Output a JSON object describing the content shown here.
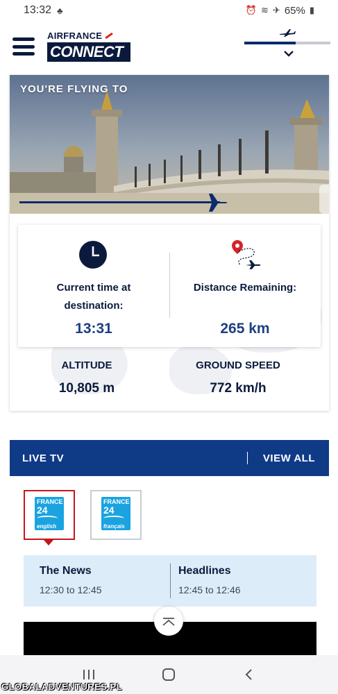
{
  "status_bar": {
    "time": "13:32",
    "battery": "65%"
  },
  "header": {
    "logo_top": "AIRFRANCE",
    "logo_bottom": "CONNECT",
    "progress_fraction": 0.6
  },
  "flight": {
    "hero_title": "YOU'RE FLYING TO",
    "route_progress_fraction": 0.67,
    "current_time_label": "Current time at destination:",
    "current_time_value": "13:31",
    "distance_label": "Distance Remaining:",
    "distance_value": "265 km",
    "altitude_label": "ALTITUDE",
    "altitude_value": "10,805 m",
    "ground_speed_label": "GROUND SPEED",
    "ground_speed_value": "772 km/h"
  },
  "live_tv": {
    "title": "LIVE TV",
    "view_all": "VIEW ALL",
    "channels": [
      {
        "name": "FRANCE",
        "number": "24",
        "lang": "english",
        "selected": true
      },
      {
        "name": "FRANCE",
        "number": "24",
        "lang": "français",
        "selected": false
      }
    ],
    "programs": [
      {
        "name": "The News",
        "time": "12:30 to 12:45"
      },
      {
        "name": "Headlines",
        "time": "12:45 to 12:46"
      }
    ]
  },
  "watermark": "GLOBALADVENTURES.PL",
  "colors": {
    "brand_navy": "#0b1a3c",
    "accent_blue": "#0f3a86",
    "value_blue": "#1d3f82",
    "selected_red": "#c4161c"
  },
  "icons": [
    "menu-icon",
    "plane-icon",
    "chevron-down-icon",
    "clock-icon",
    "distance-route-icon",
    "arrow-up-icon",
    "recent-apps-icon",
    "home-icon",
    "back-icon"
  ]
}
